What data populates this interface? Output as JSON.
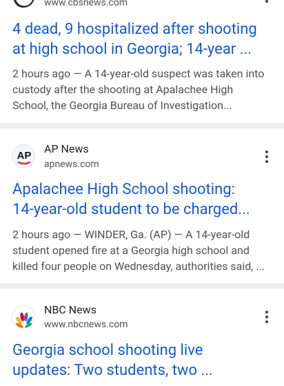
{
  "results": [
    {
      "source_url": "www.cbsnews.com",
      "headline_lines": [
        "4 dead, 9 hospitalized after shooting",
        "at high school in Georgia; 14-year ..."
      ],
      "snippet_lines": [
        "2 hours ago — A 14-year-old suspect was taken into",
        "custody after the shooting at Apalachee High",
        "School, the Georgia Bureau of Investigation..."
      ]
    },
    {
      "source_name": "AP News",
      "source_url": "apnews.com",
      "logo_text": "AP",
      "headline_lines": [
        "Apalachee High School shooting:",
        "14-year-old student to be charged..."
      ],
      "snippet_lines": [
        "2 hours ago — WINDER, Ga. (AP) — A 14-year-old",
        "student opened fire at a Georgia high school and",
        "killed four people on Wednesday, authorities said, ..."
      ]
    },
    {
      "source_name": "NBC News",
      "source_url": "www.nbcnews.com",
      "headline_lines": [
        "Georgia school shooting live",
        "updates: Two students, two ..."
      ]
    }
  ],
  "colors": {
    "headline": "#1558d6",
    "snippet": "#4d5156",
    "separator": "#ebeef1",
    "ap_red": "#e0302a"
  },
  "icons": {
    "more": "more-vert-icon",
    "cbs_logo": "cbs-eye-logo-icon",
    "ap_logo": "ap-logo-icon",
    "nbc_logo": "nbc-peacock-logo-icon"
  }
}
